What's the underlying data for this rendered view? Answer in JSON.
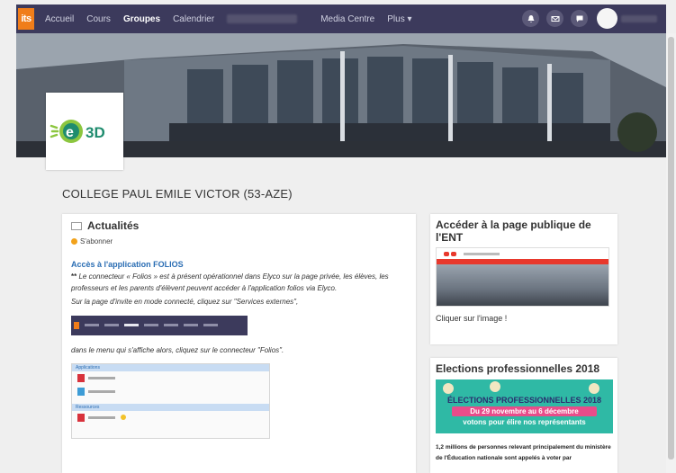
{
  "nav": {
    "logo": "its",
    "items": [
      {
        "label": "Accueil",
        "active": false
      },
      {
        "label": "Cours",
        "active": false
      },
      {
        "label": "Groupes",
        "active": true
      },
      {
        "label": "Calendrier",
        "active": false
      }
    ],
    "media": "Media Centre",
    "plus": "Plus ▾"
  },
  "logo_text": "e3D",
  "school": {
    "title": "COLLEGE PAUL EMILE VICTOR (53-AZE)"
  },
  "news": {
    "title": "Actualités",
    "subscribe": "S'abonner",
    "post_title": "Accès à l'application FOLIOS",
    "stars": "**",
    "para1": "Le connecteur « Folios » est à présent opérationnel dans Elyco sur la page privée, les élèves, les professeurs et les parents d'élèvent peuvent accéder à l'application folios via Elyco.",
    "para2": "Sur la page d'invite en mode connecté, cliquez sur \"Services externes\",",
    "para3": "dans le menu qui s'affiche alors, cliquez sur le connecteur \"Folios\".",
    "shot2_bar1": "Applications",
    "shot2_bar2": "Ressources"
  },
  "side1": {
    "title": "Accéder à la page publique de l'ENT",
    "text": "Cliquer sur l'image !"
  },
  "side2": {
    "title": "Elections professionnelles 2018",
    "img_line1": "ÉLECTIONS PROFESSIONNELLES 2018",
    "img_line2": "Du 29 novembre au 6 décembre",
    "img_line3": "votons pour élire nos représentants",
    "text": "1,2 millions de personnes relevant principalement du ministère de l'Éducation nationale sont appelés à voter par"
  },
  "colors": {
    "navbar": "#3c3a5c",
    "accent": "#f07d1a",
    "link": "#2a6db3",
    "election": "#2fb9a5"
  }
}
